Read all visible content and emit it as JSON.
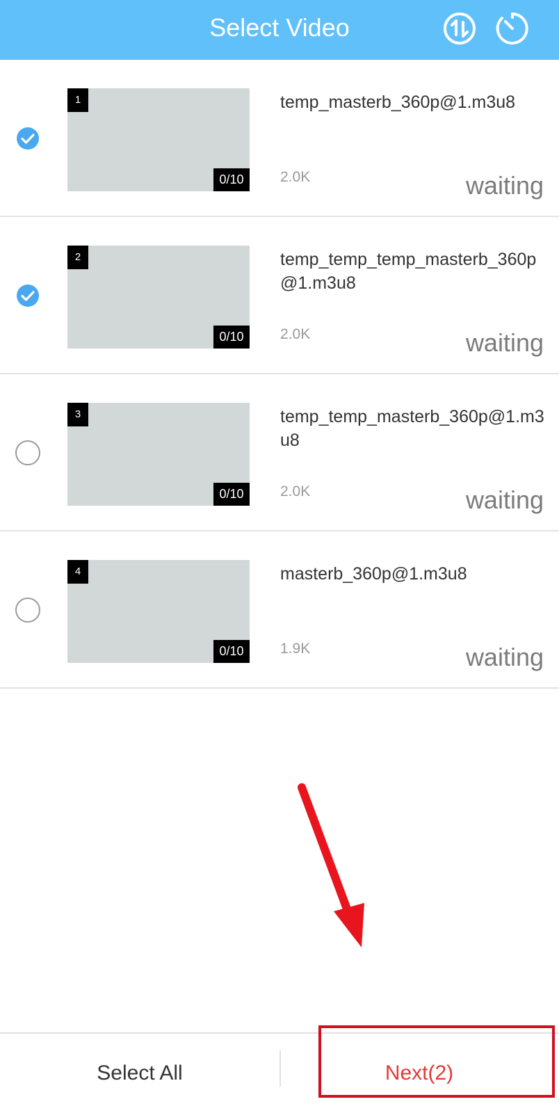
{
  "header": {
    "title": "Select Video",
    "icons": [
      "sort-icon",
      "timer-icon"
    ],
    "background": "#5fc0fa"
  },
  "videos": [
    {
      "index": "1",
      "count": "0/10",
      "name": "temp_masterb_360p@1.m3u8",
      "size": "2.0K",
      "status": "waiting",
      "selected": true
    },
    {
      "index": "2",
      "count": "0/10",
      "name": "temp_temp_temp_masterb_360p@1.m3u8",
      "size": "2.0K",
      "status": "waiting",
      "selected": true
    },
    {
      "index": "3",
      "count": "0/10",
      "name": "temp_temp_masterb_360p@1.m3u8",
      "size": "2.0K",
      "status": "waiting",
      "selected": false
    },
    {
      "index": "4",
      "count": "0/10",
      "name": "masterb_360p@1.m3u8",
      "size": "1.9K",
      "status": "waiting",
      "selected": false
    }
  ],
  "bottom_bar": {
    "select_all_label": "Select All",
    "next_label": "Next(2)"
  },
  "colors": {
    "accent": "#5fc0fa",
    "check": "#4aa8f0",
    "next": "#e53935",
    "annotation": "#d0101e"
  }
}
